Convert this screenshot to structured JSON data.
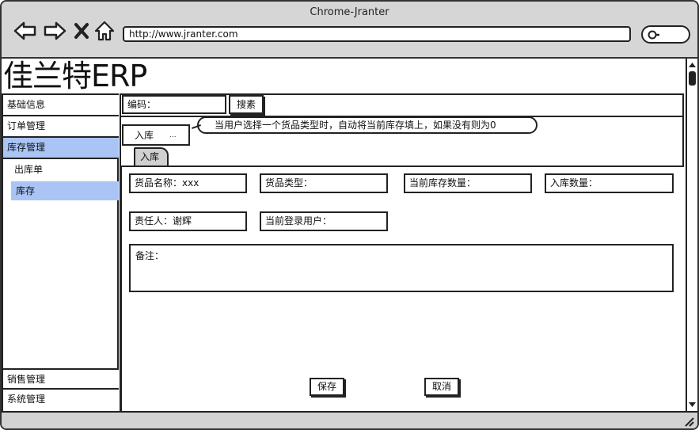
{
  "browser": {
    "title": "Chrome-Jranter",
    "url": "http://www.jranter.com",
    "back_icon": "arrow-left-icon",
    "forward_icon": "arrow-right-icon",
    "close_icon": "close-icon",
    "home_icon": "home-icon",
    "search_icon": "search-icon"
  },
  "app": {
    "logo": "佳兰特ERP"
  },
  "sidebar": {
    "items": [
      {
        "label": "基础信息"
      },
      {
        "label": "订单管理"
      },
      {
        "label": "库存管理",
        "active": true
      },
      {
        "label": "销售管理"
      },
      {
        "label": "系统管理"
      }
    ],
    "subitems": [
      {
        "label": "出库单"
      },
      {
        "label": "库存",
        "active": true
      }
    ]
  },
  "toolbar": {
    "code_label": "编码：",
    "search_label": "搜素"
  },
  "tab_select": {
    "value": "入库",
    "more": "..."
  },
  "tooltip": {
    "text": "当用户选择一个货品类型时，自动将当前库存填上，如果没有则为0"
  },
  "tabs": [
    {
      "label": "入库",
      "active": true
    }
  ],
  "form": {
    "product_name": "货品名称：xxx",
    "product_type": "货品类型：",
    "current_stock": "当前库存数量：",
    "in_quantity": "入库数量：",
    "responsible": "责任人：谢辉",
    "current_user": "当前登录用户：",
    "remark": "备注："
  },
  "actions": {
    "save_label": "保存",
    "cancel_label": "取消"
  },
  "colors": {
    "active_bg": "#a9c4f5",
    "chrome_bg": "#d6d6d6",
    "border": "#222222"
  }
}
